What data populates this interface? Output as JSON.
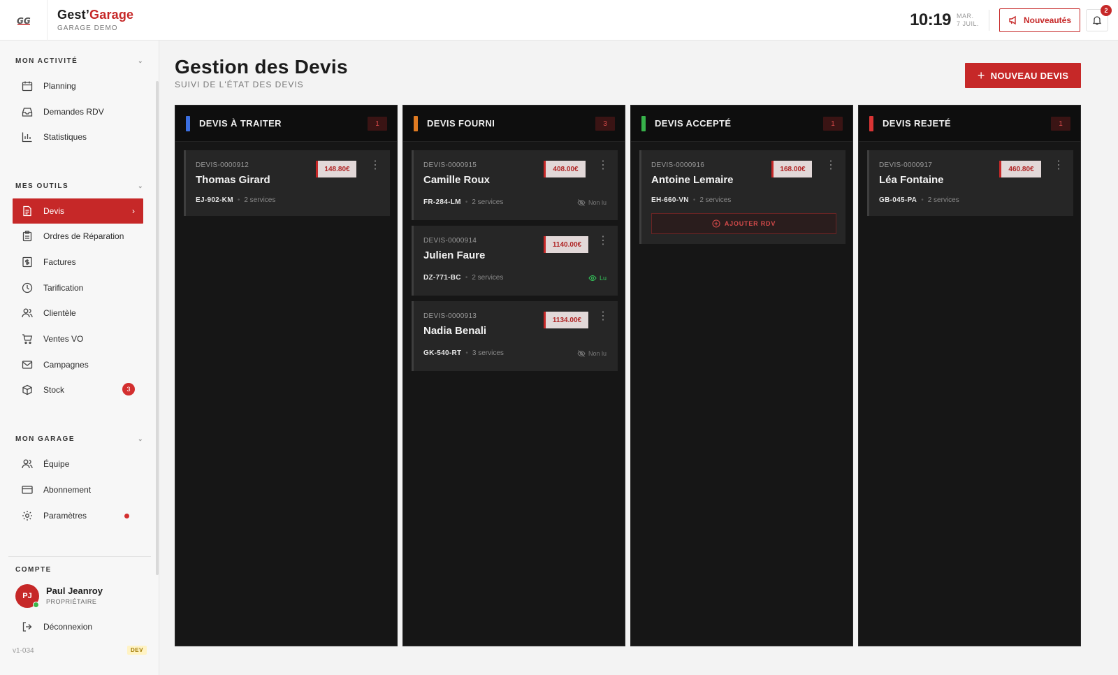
{
  "header": {
    "logo_text": "GG",
    "brand_part1": "Gest’",
    "brand_part2": "Garage",
    "brand_sub": "GARAGE DEMO",
    "time": "10:19",
    "date_line1": "MAR.",
    "date_line2": "7 JUIL.",
    "news_label": "Nouveautés",
    "notif_count": "2"
  },
  "sidebar": {
    "sections": [
      {
        "title": "MON ACTIVITÉ",
        "items": [
          {
            "label": "Planning",
            "icon": "calendar-icon"
          },
          {
            "label": "Demandes RDV",
            "icon": "inbox-icon"
          },
          {
            "label": "Statistiques",
            "icon": "bar-chart-icon"
          }
        ]
      },
      {
        "title": "MES OUTILS",
        "items": [
          {
            "label": "Devis",
            "icon": "document-icon",
            "active": true
          },
          {
            "label": "Ordres de Réparation",
            "icon": "clipboard-icon"
          },
          {
            "label": "Factures",
            "icon": "invoice-icon"
          },
          {
            "label": "Tarification",
            "icon": "clock-icon"
          },
          {
            "label": "Clientèle",
            "icon": "users-icon"
          },
          {
            "label": "Ventes VO",
            "icon": "cart-icon"
          },
          {
            "label": "Campagnes",
            "icon": "mail-icon"
          },
          {
            "label": "Stock",
            "icon": "box-icon",
            "badge": "3"
          }
        ]
      },
      {
        "title": "MON GARAGE",
        "items": [
          {
            "label": "Équipe",
            "icon": "team-icon"
          },
          {
            "label": "Abonnement",
            "icon": "card-icon"
          },
          {
            "label": "Paramètres",
            "icon": "gear-icon",
            "dot": true
          }
        ]
      }
    ],
    "account": {
      "title": "COMPTE",
      "initials": "PJ",
      "name": "Paul Jeanroy",
      "role": "PROPRIÉTAIRE",
      "logout": "Déconnexion"
    },
    "version": "v1-034",
    "env": "DEV"
  },
  "main": {
    "title": "Gestion des Devis",
    "subtitle": "SUIVI DE L'ÉTAT DES DEVIS",
    "new_button": "NOUVEAU DEVIS",
    "columns": [
      {
        "title": "DEVIS À TRAITER",
        "count": "1",
        "color": "#3b6fe0",
        "cards": [
          {
            "ref": "DEVIS-0000912",
            "name": "Thomas Girard",
            "price": "148.80€",
            "plate": "EJ-902-KM",
            "services": "2 services"
          }
        ]
      },
      {
        "title": "DEVIS FOURNI",
        "count": "3",
        "color": "#e07b22",
        "cards": [
          {
            "ref": "DEVIS-0000915",
            "name": "Camille Roux",
            "price": "408.00€",
            "plate": "FR-284-LM",
            "services": "2 services",
            "status": "Non lu"
          },
          {
            "ref": "DEVIS-0000914",
            "name": "Julien Faure",
            "price": "1140.00€",
            "plate": "DZ-771-BC",
            "services": "2 services",
            "status": "Lu"
          },
          {
            "ref": "DEVIS-0000913",
            "name": "Nadia Benali",
            "price": "1134.00€",
            "plate": "GK-540-RT",
            "services": "3 services",
            "status": "Non lu"
          }
        ]
      },
      {
        "title": "DEVIS ACCEPTÉ",
        "count": "1",
        "color": "#37b14a",
        "cards": [
          {
            "ref": "DEVIS-0000916",
            "name": "Antoine Lemaire",
            "price": "168.00€",
            "plate": "EH-660-VN",
            "services": "2 services",
            "action": "AJOUTER RDV"
          }
        ]
      },
      {
        "title": "DEVIS REJETÉ",
        "count": "1",
        "color": "#d93434",
        "cards": [
          {
            "ref": "DEVIS-0000917",
            "name": "Léa Fontaine",
            "price": "460.80€",
            "plate": "GB-045-PA",
            "services": "2 services"
          }
        ]
      }
    ]
  }
}
